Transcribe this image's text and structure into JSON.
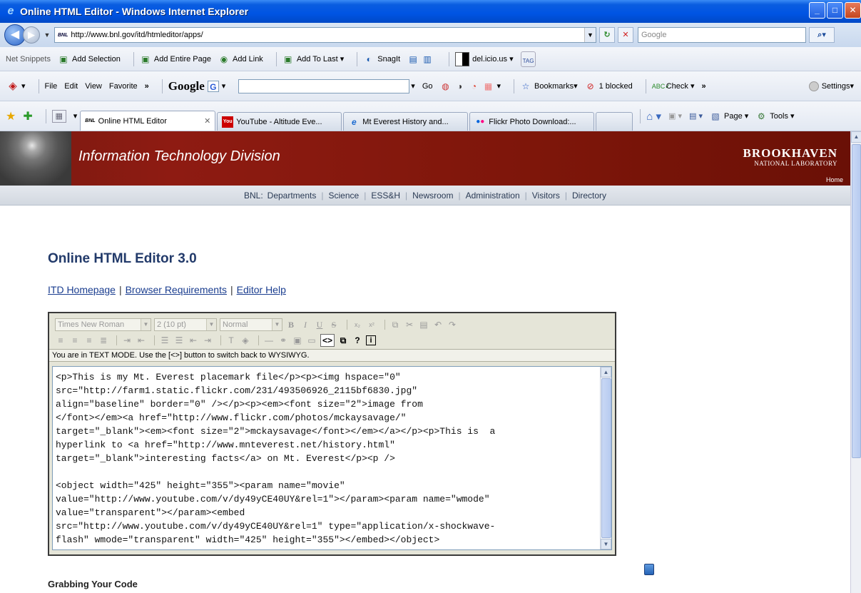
{
  "window": {
    "title": "Online HTML Editor - Windows Internet Explorer",
    "controls": {
      "minimize": "_",
      "maximize": "□",
      "close": "✕"
    }
  },
  "address": {
    "url": "http://www.bnl.gov/itd/htmleditor/apps/",
    "favicon": "BNL",
    "search_placeholder": "Google"
  },
  "toolbar1": {
    "items": [
      "Net Snippets",
      "Add Selection",
      "Add Entire Page",
      "Add Link",
      "Add To Last",
      "SnagIt",
      "del.icio.us",
      "TAG"
    ]
  },
  "toolbar2": {
    "menus": [
      "File",
      "Edit",
      "View",
      "Favorite"
    ],
    "overflow": "»",
    "google_logo": "Google",
    "go_label": "Go",
    "bookmarks_label": "Bookmarks",
    "blocked_label": "1 blocked",
    "check_label": "Check",
    "settings_label": "Settings"
  },
  "tabs": {
    "items": [
      {
        "label": "Online HTML Editor",
        "active": true
      },
      {
        "label": "YouTube - Altitude Eve...",
        "active": false
      },
      {
        "label": "Mt Everest History and...",
        "active": false
      },
      {
        "label": "Flickr Photo Download:...",
        "active": false
      }
    ],
    "page_menu": "Page",
    "tools_menu": "Tools"
  },
  "banner": {
    "division": "Information Technology Division",
    "brand": "BROOKHAVEN",
    "brand_sub": "NATIONAL LABORATORY",
    "home_link": "Home"
  },
  "nav": {
    "prefix": "BNL:",
    "links": [
      "Departments",
      "Science",
      "ESS&H",
      "Newsroom",
      "Administration",
      "Visitors",
      "Directory"
    ]
  },
  "content": {
    "heading": "Online HTML Editor 3.0",
    "links": [
      "ITD Homepage",
      "Browser Requirements",
      "Editor Help"
    ],
    "section_heading": "Grabbing Your Code"
  },
  "editor": {
    "font_select": "Times New Roman",
    "size_select": "2 (10 pt)",
    "format_select": "Normal",
    "mode_message": "You are in TEXT MODE. Use the [<>] button to switch back to WYSIWYG.",
    "source_text": "<p>This is my Mt. Everest placemark file</p><p><img hspace=\"0\"\nsrc=\"http://farm1.static.flickr.com/231/493506926_2115bf6830.jpg\"\nalign=\"baseline\" border=\"0\" /></p><p><em><font size=\"2\">image from\n</font></em><a href=\"http://www.flickr.com/photos/mckaysavage/\"\ntarget=\"_blank\"><em><font size=\"2\">mckaysavage</font></em></a></p><p>This is  a\nhyperlink to <a href=\"http://www.mnteverest.net/history.html\"\ntarget=\"_blank\">interesting facts</a> on Mt. Everest</p><p />\n\n<object width=\"425\" height=\"355\"><param name=\"movie\"\nvalue=\"http://www.youtube.com/v/dy49yCE40UY&rel=1\"></param><param name=\"wmode\"\nvalue=\"transparent\"></param><embed\nsrc=\"http://www.youtube.com/v/dy49yCE40UY&rel=1\" type=\"application/x-shockwave-\nflash\" wmode=\"transparent\" width=\"425\" height=\"355\"></embed></object>"
  }
}
